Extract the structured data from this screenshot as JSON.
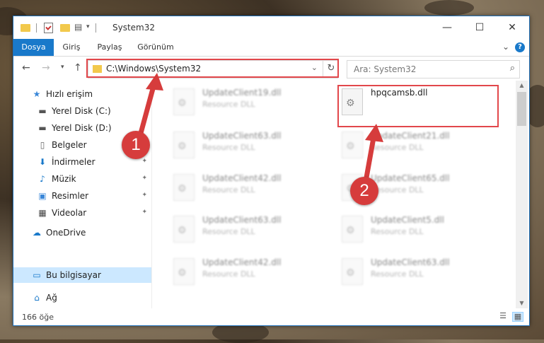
{
  "window": {
    "title": "System32"
  },
  "ribbon": {
    "tabs": [
      {
        "label": "Dosya",
        "active": true
      },
      {
        "label": "Giriş"
      },
      {
        "label": "Paylaş"
      },
      {
        "label": "Görünüm"
      }
    ]
  },
  "address": {
    "path": "C:\\Windows\\System32"
  },
  "search": {
    "placeholder": "Ara: System32"
  },
  "sidebar": {
    "items": [
      {
        "label": "Hızlı erişim",
        "icon": "star-icon"
      },
      {
        "label": "Yerel Disk (C:)",
        "icon": "drive-icon"
      },
      {
        "label": "Yerel Disk (D:)",
        "icon": "drive-icon"
      },
      {
        "label": "Belgeler",
        "icon": "document-icon"
      },
      {
        "label": "İndirmeler",
        "icon": "download-icon"
      },
      {
        "label": "Müzik",
        "icon": "music-icon"
      },
      {
        "label": "Resimler",
        "icon": "pictures-icon"
      },
      {
        "label": "Videolar",
        "icon": "video-icon"
      },
      {
        "label": "OneDrive",
        "icon": "cloud-icon"
      },
      {
        "label": "Bu bilgisayar",
        "icon": "computer-icon",
        "selected": true
      },
      {
        "label": "Ağ",
        "icon": "network-icon"
      }
    ]
  },
  "files": {
    "left": [
      {
        "name": "UpdateClient19.dll",
        "type": "Resource DLL"
      },
      {
        "name": "UpdateClient63.dll",
        "type": "Resource DLL"
      },
      {
        "name": "UpdateClient42.dll",
        "type": "Resource DLL"
      },
      {
        "name": "UpdateClient63.dll",
        "type": "Resource DLL"
      },
      {
        "name": "UpdateClient42.dll",
        "type": "Resource DLL"
      }
    ],
    "right": [
      {
        "name": "hpqcamsb.dll",
        "type": ""
      },
      {
        "name": "UpdateClient21.dll",
        "type": "Resource DLL"
      },
      {
        "name": "UpdateClient65.dll",
        "type": "Resource DLL"
      },
      {
        "name": "UpdateClient5.dll",
        "type": "Resource DLL"
      },
      {
        "name": "UpdateClient63.dll",
        "type": "Resource DLL"
      }
    ]
  },
  "status": {
    "item_count": "166 öğe"
  },
  "annotations": {
    "step1": "1",
    "step2": "2"
  },
  "colors": {
    "accent": "#1979ca",
    "highlight": "#e2474b",
    "badge": "#d63c3c"
  }
}
